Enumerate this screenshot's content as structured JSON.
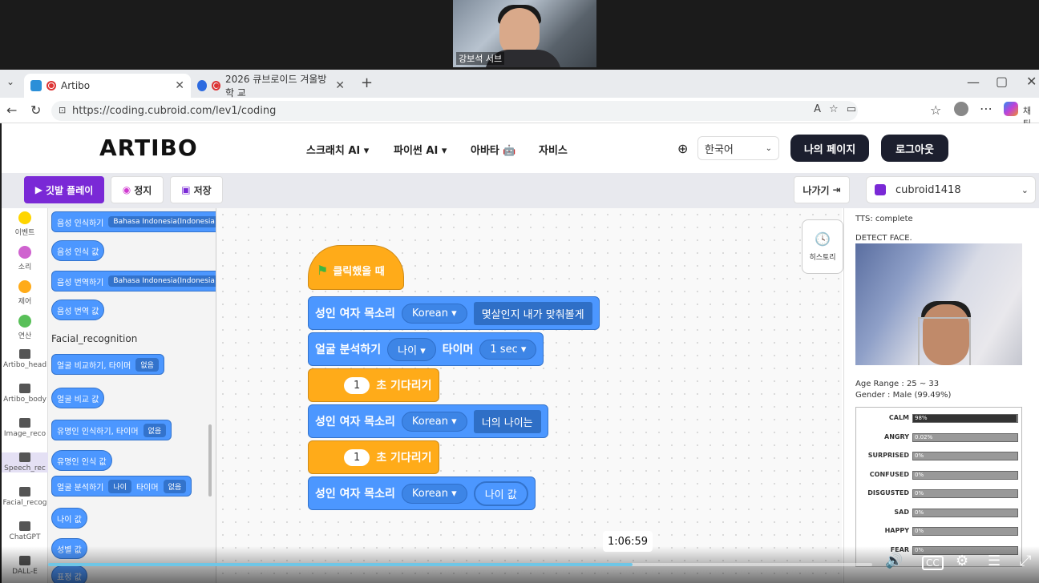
{
  "webcam": {
    "name": "강보석 서브"
  },
  "browser": {
    "tabs": [
      {
        "label": "Artibo"
      },
      {
        "label": "2026 큐브로이드 겨울방학 교"
      }
    ],
    "url": "https://coding.cubroid.com/lev1/coding",
    "right_label": "채팅"
  },
  "header": {
    "logo": "ARTIBO",
    "nav": [
      "스크래치 AI",
      "파이썬 AI",
      "아바타 🤖",
      "자비스"
    ],
    "language": "한국어",
    "mypage": "나의 페이지",
    "logout": "로그아웃"
  },
  "toolbar": {
    "play": "깃발 플레이",
    "stop": "정지",
    "save": "저장",
    "exit": "나가기",
    "user": "cubroid1418"
  },
  "categories": [
    "이벤트",
    "소리",
    "제어",
    "연산",
    "Artibo_head",
    "Artibo_body",
    "Image_reco",
    "Speech_rec",
    "Facial_recog",
    "ChatGPT",
    "DALL-E"
  ],
  "category_colors": [
    "#ffd500",
    "#cf63cf",
    "#ffab19",
    "#59c059"
  ],
  "flyout": {
    "blocks": [
      {
        "text": "음성 인식하기",
        "dd": "Bahasa Indonesia(Indonesia"
      },
      {
        "text": "음성 인식 값"
      },
      {
        "text": "음성 번역하기",
        "dd": "Bahasa Indonesia(Indonesia"
      },
      {
        "text": "음성 번역 값"
      },
      {
        "text": "얼굴 비교하기, 타이머",
        "dd": "없음"
      },
      {
        "text": "얼굴 비교 값"
      },
      {
        "text": "유명인 인식하기, 타이머",
        "dd": "없음"
      },
      {
        "text": "유명인 인식 값"
      },
      {
        "text": "얼굴 분석하기",
        "dd": "나이",
        "text2": "타이머",
        "dd2": "없음"
      },
      {
        "text": "나이 값"
      },
      {
        "text": "성별 값"
      },
      {
        "text": "표정 값"
      }
    ],
    "section": "Facial_recognition"
  },
  "script": {
    "hat": "클릭했을 때",
    "b1": {
      "text": "성인 여자 목소리",
      "dd": "Korean",
      "msg": "몇살인지 내가 맞춰볼게"
    },
    "b2": {
      "text": "얼굴 분석하기",
      "dd": "나이",
      "text2": "타이머",
      "dd2": "1 sec"
    },
    "b3": {
      "num": "1",
      "text": "초 기다리기"
    },
    "b4": {
      "text": "성인 여자 목소리",
      "dd": "Korean",
      "msg": "너의 나이는"
    },
    "b5": {
      "num": "1",
      "text": "초 기다리기"
    },
    "b6": {
      "text": "성인 여자 목소리",
      "dd": "Korean",
      "rep": "나이 값"
    }
  },
  "history": "히스토리",
  "panel": {
    "tts": "TTS: complete",
    "detect": "DETECT FACE.",
    "age_range": "Age Range : 25 ~ 33",
    "gender": "Gender : Male (99.49%)",
    "emotions": [
      {
        "label": "CALM",
        "pct": 99.0,
        "val": "98%"
      },
      {
        "label": "ANGRY",
        "pct": 0.02,
        "val": "0.02%"
      },
      {
        "label": "SURPRISED",
        "pct": 0,
        "val": "0%"
      },
      {
        "label": "CONFUSED",
        "pct": 0,
        "val": "0%"
      },
      {
        "label": "DISGUSTED",
        "pct": 0,
        "val": "0%"
      },
      {
        "label": "SAD",
        "pct": 0,
        "val": "0%"
      },
      {
        "label": "HAPPY",
        "pct": 0,
        "val": "0%"
      },
      {
        "label": "FEAR",
        "pct": 0,
        "val": "0%"
      }
    ]
  },
  "video": {
    "time": "1:06:59",
    "progress": 0.709
  }
}
